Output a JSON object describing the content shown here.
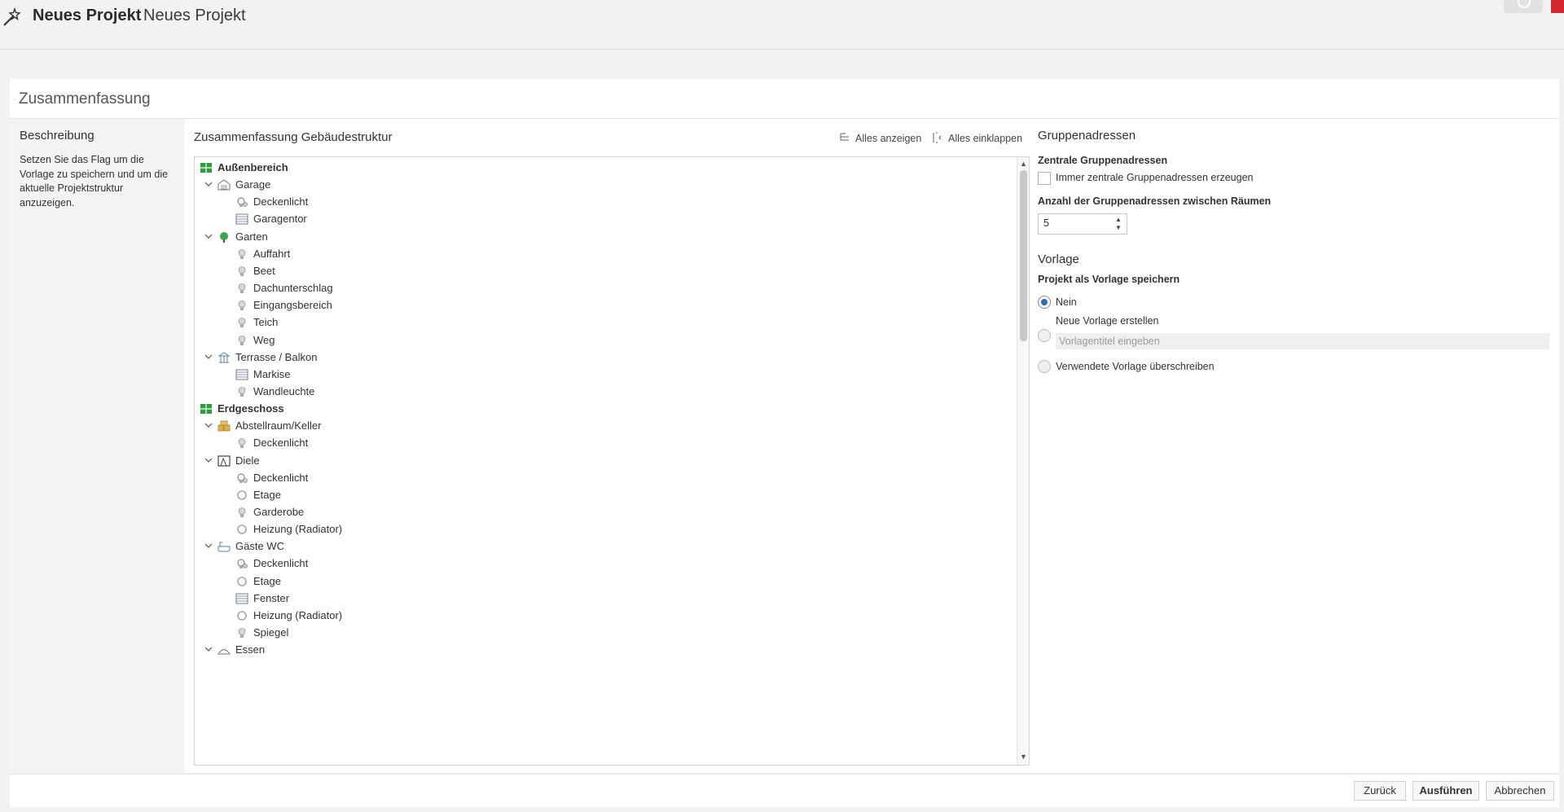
{
  "window": {
    "title_bold": "Neues Projekt",
    "title": "Neues Projekt"
  },
  "section": {
    "title": "Zusammenfassung"
  },
  "description": {
    "title": "Beschreibung",
    "text": "Setzen Sie das Flag um die Vorlage zu speichern und um die aktuelle Projektstruktur anzuzeigen."
  },
  "tree": {
    "title": "Zusammenfassung Gebäudestruktur",
    "show_all": "Alles anzeigen",
    "collapse_all": "Alles einklappen",
    "rows": [
      {
        "label": "Außenbereich",
        "level": 0,
        "icon": "floor-icon"
      },
      {
        "label": "Garage",
        "level": 1,
        "icon": "garage-icon"
      },
      {
        "label": "Deckenlicht",
        "level": 2,
        "icon": "dimmer-lamp-icon"
      },
      {
        "label": "Garagentor",
        "level": 2,
        "icon": "shutter-icon"
      },
      {
        "label": "Garten",
        "level": 1,
        "icon": "tree-icon"
      },
      {
        "label": "Auffahrt",
        "level": 2,
        "icon": "bulb-icon"
      },
      {
        "label": "Beet",
        "level": 2,
        "icon": "bulb-icon"
      },
      {
        "label": "Dachunterschlag",
        "level": 2,
        "icon": "bulb-icon"
      },
      {
        "label": "Eingangsbereich",
        "level": 2,
        "icon": "bulb-icon"
      },
      {
        "label": "Teich",
        "level": 2,
        "icon": "bulb-icon"
      },
      {
        "label": "Weg",
        "level": 2,
        "icon": "bulb-icon"
      },
      {
        "label": "Terrasse / Balkon",
        "level": 1,
        "icon": "terrace-icon"
      },
      {
        "label": "Markise",
        "level": 2,
        "icon": "shutter-icon"
      },
      {
        "label": "Wandleuchte",
        "level": 2,
        "icon": "bulb-icon"
      },
      {
        "label": "Erdgeschoss",
        "level": 0,
        "icon": "floor-icon"
      },
      {
        "label": "Abstellraum/Keller",
        "level": 1,
        "icon": "storage-icon"
      },
      {
        "label": "Deckenlicht",
        "level": 2,
        "icon": "bulb-icon"
      },
      {
        "label": "Diele",
        "level": 1,
        "icon": "hall-icon"
      },
      {
        "label": "Deckenlicht",
        "level": 2,
        "icon": "dimmer-lamp-icon"
      },
      {
        "label": "Etage",
        "level": 2,
        "icon": "ring-icon"
      },
      {
        "label": "Garderobe",
        "level": 2,
        "icon": "bulb-icon"
      },
      {
        "label": "Heizung (Radiator)",
        "level": 2,
        "icon": "ring-icon"
      },
      {
        "label": "Gäste WC",
        "level": 1,
        "icon": "bath-icon"
      },
      {
        "label": "Deckenlicht",
        "level": 2,
        "icon": "dimmer-lamp-icon"
      },
      {
        "label": "Etage",
        "level": 2,
        "icon": "ring-icon"
      },
      {
        "label": "Fenster",
        "level": 2,
        "icon": "shutter-icon"
      },
      {
        "label": "Heizung (Radiator)",
        "level": 2,
        "icon": "ring-icon"
      },
      {
        "label": "Spiegel",
        "level": 2,
        "icon": "bulb-icon"
      },
      {
        "label": "Essen",
        "level": 1,
        "icon": "dining-icon"
      }
    ]
  },
  "group_addresses": {
    "title": "Gruppenadressen",
    "central_label": "Zentrale Gruppenadressen",
    "central_checkbox": "Immer zentrale Gruppenadressen erzeugen",
    "count_label": "Anzahl der Gruppenadressen zwischen Räumen",
    "count_value": "5"
  },
  "template": {
    "title": "Vorlage",
    "save_label": "Projekt als Vorlage speichern",
    "option_no": "Nein",
    "option_new": "Neue Vorlage erstellen",
    "new_placeholder": "Vorlagentitel eingeben",
    "option_overwrite": "Verwendete Vorlage überschreiben"
  },
  "footer": {
    "back": "Zurück",
    "run": "Ausführen",
    "cancel": "Abbrechen"
  }
}
